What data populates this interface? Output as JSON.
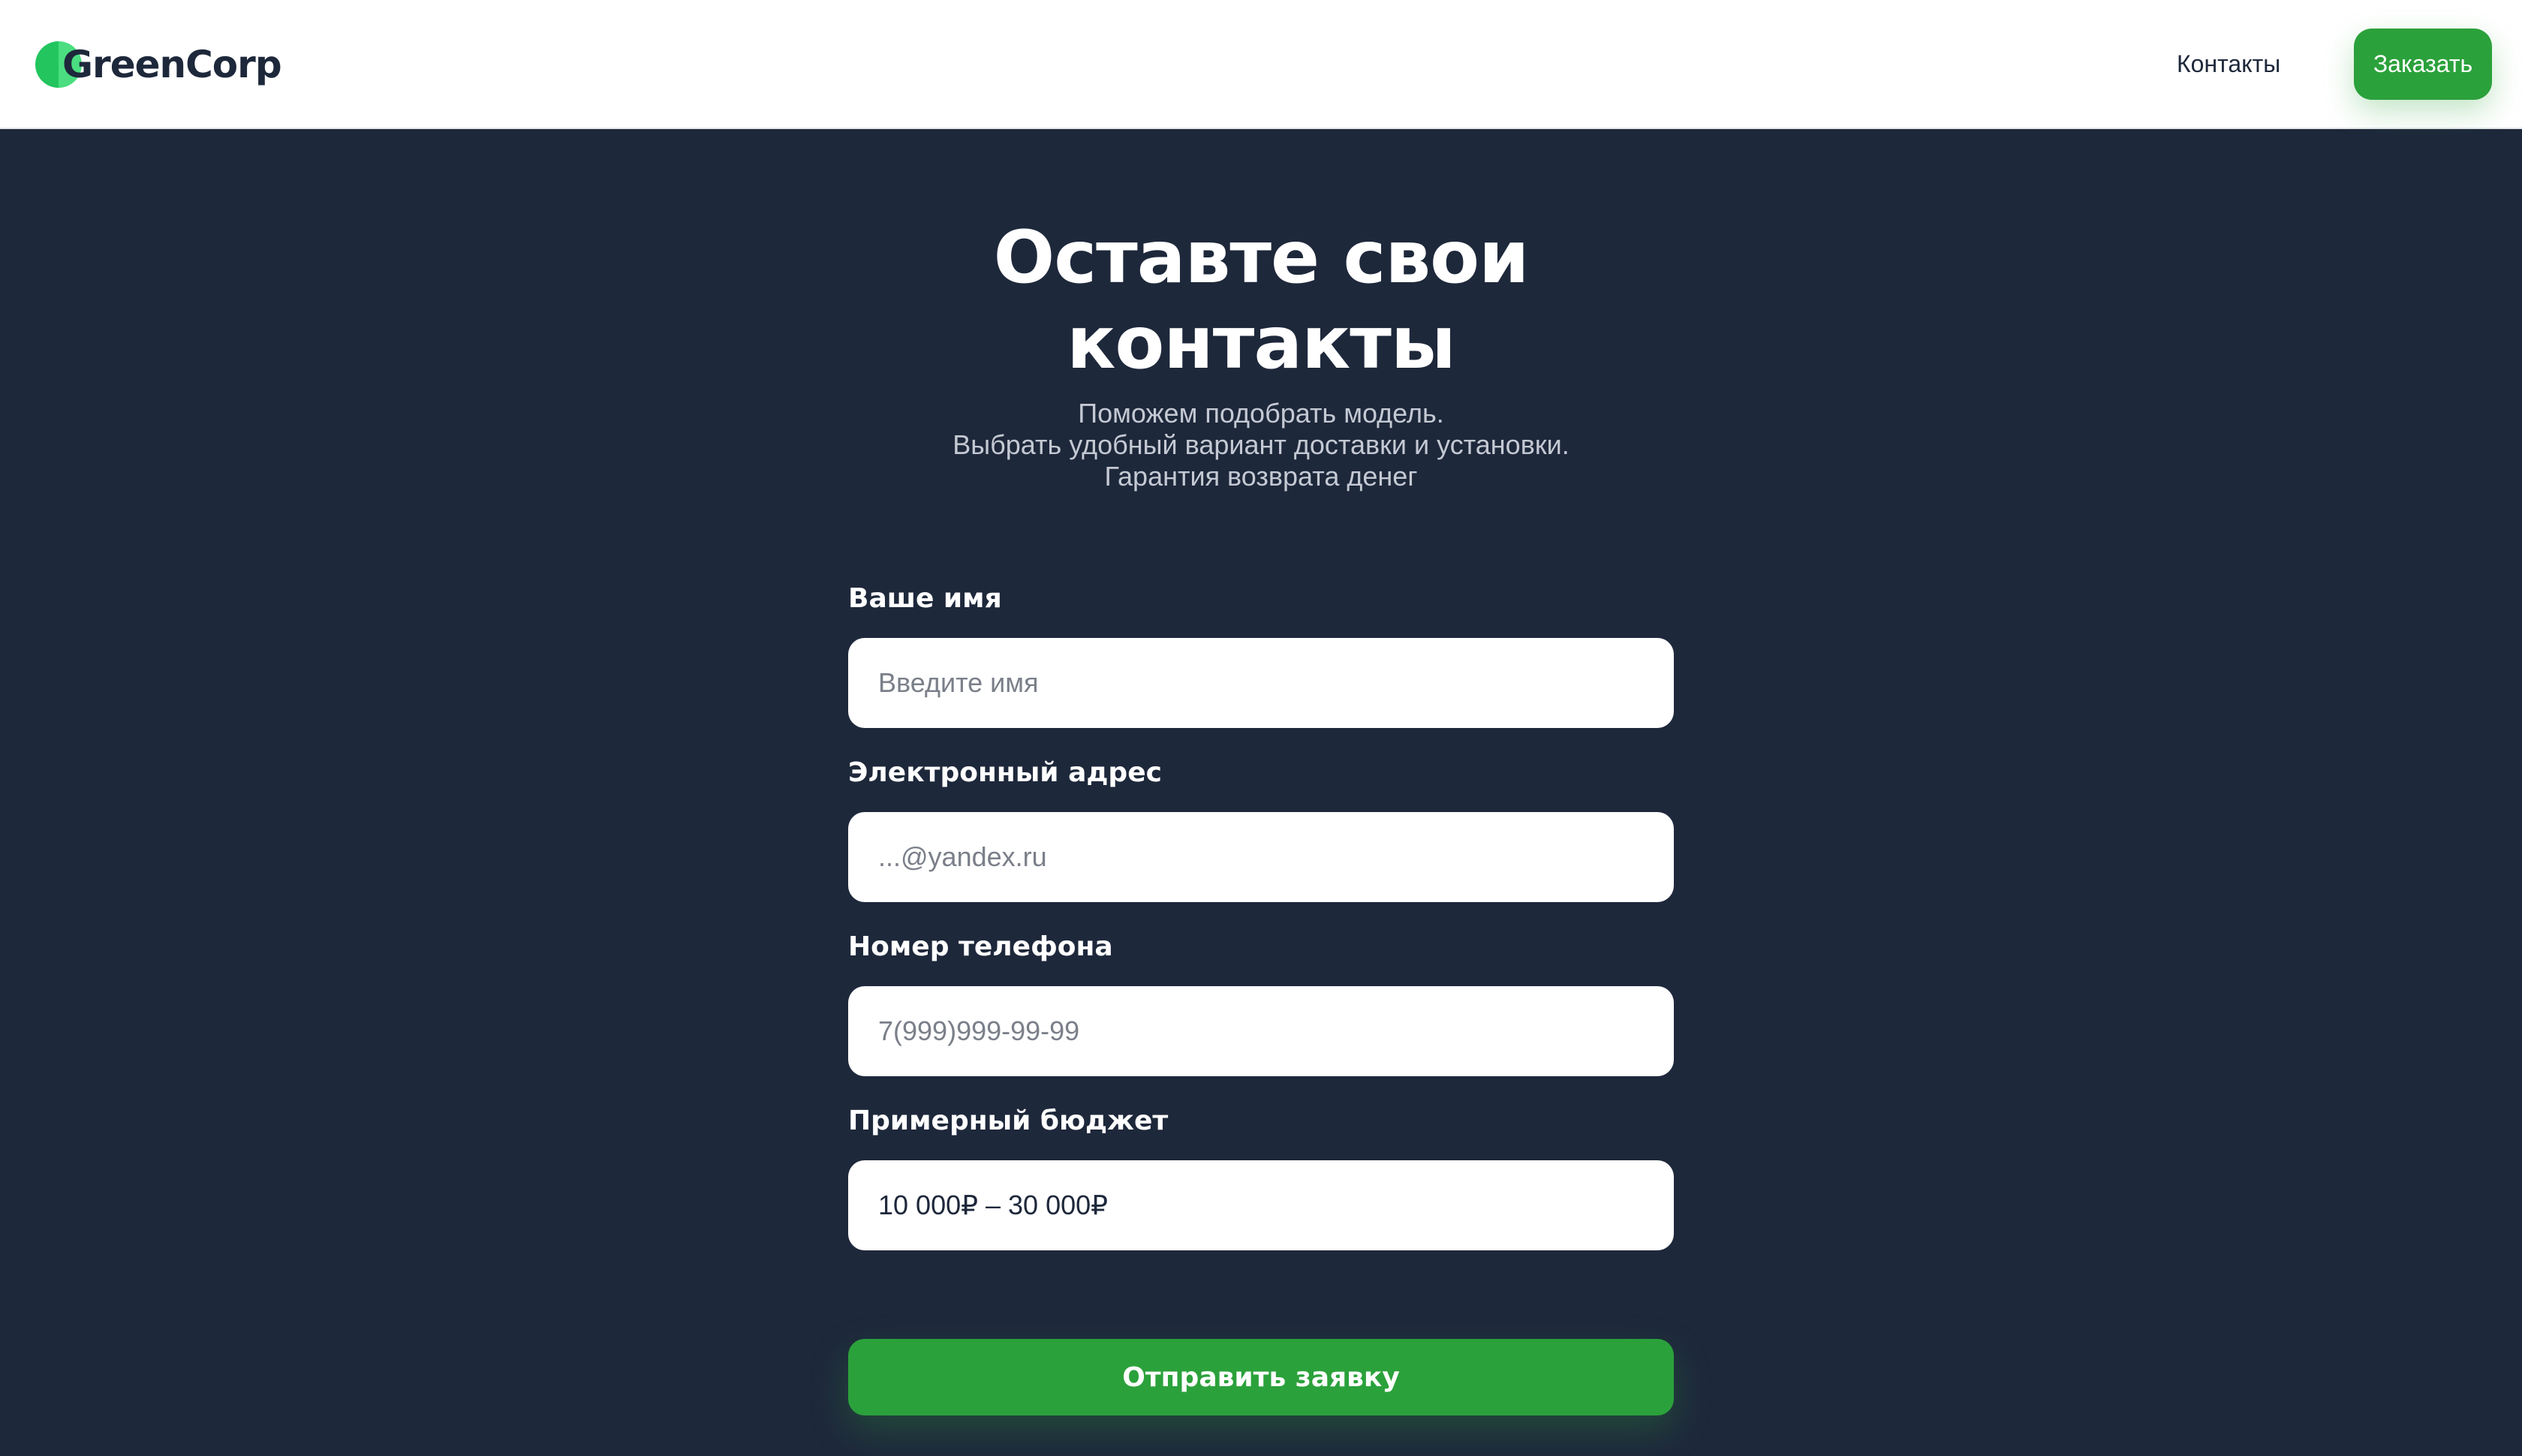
{
  "header": {
    "logo_text": "GreenCorp",
    "nav_contacts": "Контакты",
    "order_button": "Заказать"
  },
  "hero": {
    "title_line1": "Оставте свои",
    "title_line2": "контакты",
    "subtitle_lines": [
      "Поможем подобрать модель.",
      "Выбрать удобный вариант доставки и установки.",
      "Гарантия возврата денег"
    ]
  },
  "form": {
    "name_label": "Ваше имя",
    "name_placeholder": "Введите имя",
    "email_label": "Электронный адрес",
    "email_placeholder": "...@yandex.ru",
    "phone_label": "Номер телефона",
    "phone_placeholder": "7(999)999-99-99",
    "budget_label": "Примерный бюджет",
    "budget_value": "10 000₽ – 30 000₽",
    "submit_label": "Отправить заявку"
  },
  "colors": {
    "background": "#1e283b",
    "accent": "#2ba13b",
    "logo_green": "#22c55e"
  }
}
